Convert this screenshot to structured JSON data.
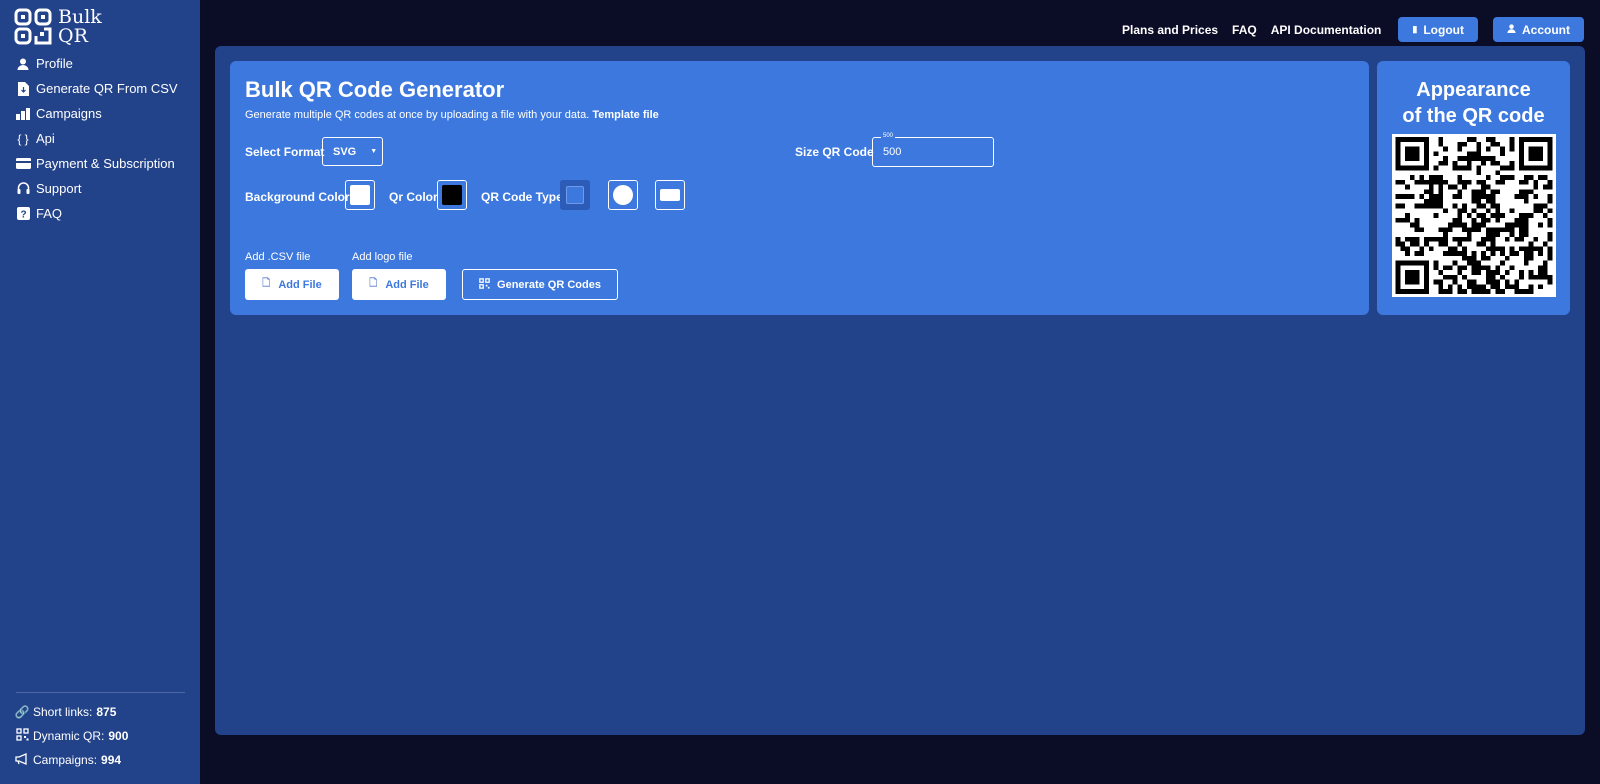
{
  "logo": {
    "line1": "Bulk",
    "line2": "QR"
  },
  "sidebar": {
    "items": [
      {
        "label": "Profile",
        "icon": "user-icon"
      },
      {
        "label": "Generate QR From CSV",
        "icon": "file-download-icon"
      },
      {
        "label": "Campaigns",
        "icon": "city-icon"
      },
      {
        "label": "Api",
        "icon": "braces-icon"
      },
      {
        "label": "Payment & Subscription",
        "icon": "credit-card-icon"
      },
      {
        "label": "Support",
        "icon": "headset-icon"
      },
      {
        "label": "FAQ",
        "icon": "question-icon"
      }
    ],
    "stats": [
      {
        "label": "Short links:",
        "value": "875",
        "icon": "link-icon"
      },
      {
        "label": "Dynamic QR:",
        "value": "900",
        "icon": "qr-icon"
      },
      {
        "label": "Campaigns:",
        "value": "994",
        "icon": "megaphone-icon"
      }
    ]
  },
  "topnav": {
    "links": [
      "Plans and Prices",
      "FAQ",
      "API Documentation"
    ],
    "logout": "Logout",
    "account": "Account"
  },
  "generator": {
    "title": "Bulk QR Code Generator",
    "subtitle": "Generate multiple QR codes at once by uploading a file with your data.",
    "template_link": "Template file",
    "format_label": "Select Format",
    "format_value": "SVG",
    "size_label": "Size QR Code",
    "size_legend": "500",
    "size_value": "500",
    "bg_color_label": "Background Color",
    "qr_color_label": "Qr Color",
    "qr_type_label": "QR Code Type",
    "csv_label": "Add .CSV file",
    "logo_label": "Add logo file",
    "add_file": "Add File",
    "generate": "Generate QR Codes",
    "colors": {
      "background": "#ffffff",
      "qr": "#000000",
      "accent": "#3c78dd"
    }
  },
  "preview": {
    "title_line1": "Appearance",
    "title_line2": "of the QR code"
  }
}
